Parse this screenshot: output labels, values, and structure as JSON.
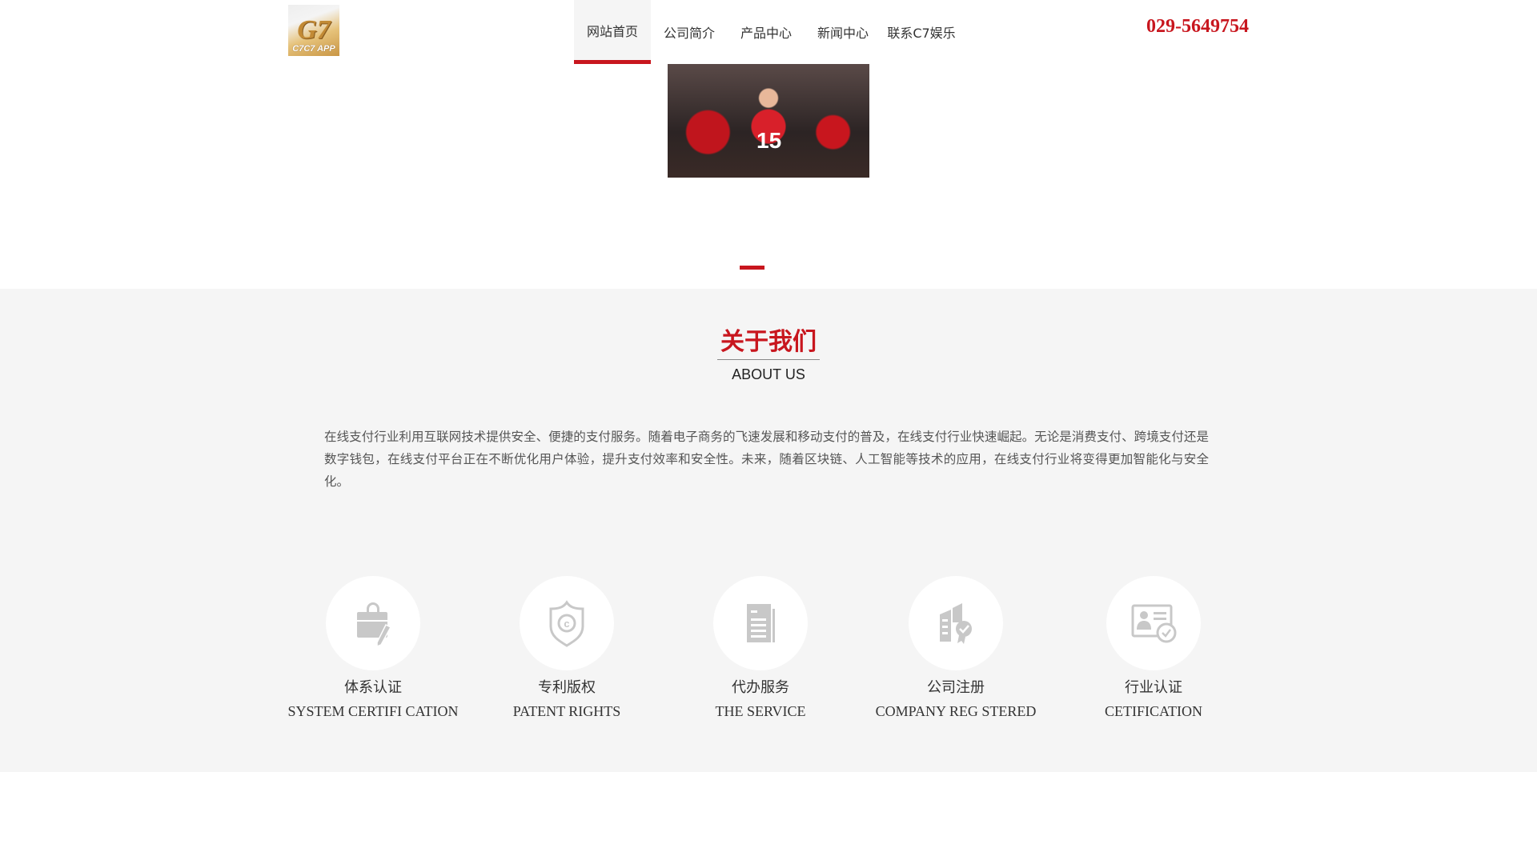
{
  "header": {
    "logo_text": "C7C7 APP",
    "nav": [
      {
        "label": "网站首页",
        "active": true
      },
      {
        "label": "公司简介"
      },
      {
        "label": "产品中心"
      },
      {
        "label": "新闻中心"
      },
      {
        "label": "联系C7娱乐"
      }
    ],
    "phone": "029-5649754"
  },
  "banner": {
    "jersey_number": "15",
    "slides": 1,
    "active_slide": 1
  },
  "about": {
    "title": "关于我们",
    "subtitle": "ABOUT US",
    "text": "在线支付行业利用互联网技术提供安全、便捷的支付服务。随着电子商务的飞速发展和移动支付的普及，在线支付行业快速崛起。无论是消费支付、跨境支付还是数字钱包，在线支付平台正在不断优化用户体验，提升支付效率和安全性。未来，随着区块链、人工智能等技术的应用，在线支付行业将变得更加智能化与安全化。"
  },
  "services": [
    {
      "cn": "体系认证",
      "en": "SYSTEM CERTIFI CATION",
      "icon": "briefcase-pen-icon"
    },
    {
      "cn": "专利版权",
      "en": "PATENT RIGHTS",
      "icon": "copyright-shield-icon"
    },
    {
      "cn": "代办服务",
      "en": "THE SERVICE",
      "icon": "document-icon"
    },
    {
      "cn": "公司注册",
      "en": "COMPANY REG STERED",
      "icon": "building-badge-icon"
    },
    {
      "cn": "行业认证",
      "en": "CETIFICATION",
      "icon": "id-card-check-icon"
    }
  ],
  "colors": {
    "accent": "#c8161e",
    "section_bg": "#f5f5f5",
    "icon": "#c8c8c8"
  }
}
